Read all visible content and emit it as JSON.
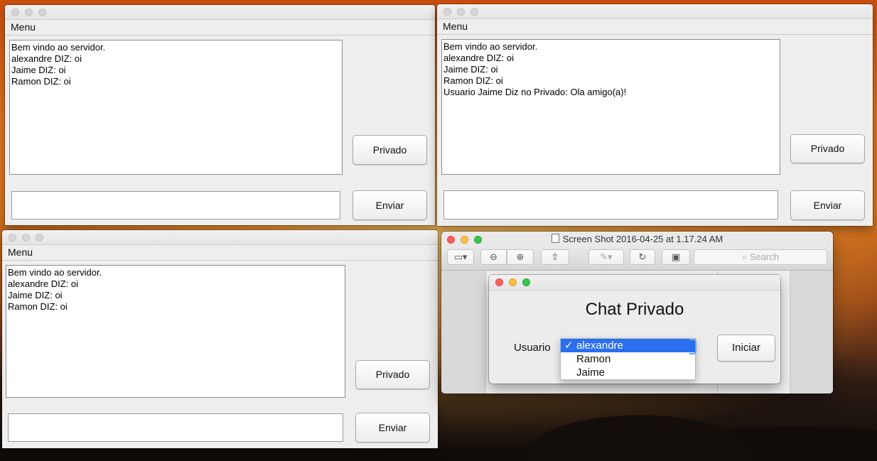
{
  "windows": [
    {
      "menu_label": "Menu",
      "messages": [
        "Bem vindo ao servidor.",
        "alexandre DIZ: oi",
        "Jaime DIZ: oi",
        "Ramon DIZ: oi"
      ],
      "privado_label": "Privado",
      "enviar_label": "Enviar",
      "input_value": ""
    },
    {
      "menu_label": "Menu",
      "messages": [
        "Bem vindo ao servidor.",
        "alexandre DIZ: oi",
        "Jaime DIZ: oi",
        "Ramon DIZ: oi",
        "Usuario Jaime Diz no Privado: Ola amigo(a)!"
      ],
      "privado_label": "Privado",
      "enviar_label": "Enviar",
      "input_value": ""
    },
    {
      "menu_label": "Menu",
      "messages": [
        "Bem vindo ao servidor.",
        "alexandre DIZ: oi",
        "Jaime DIZ: oi",
        "Ramon DIZ: oi"
      ],
      "privado_label": "Privado",
      "enviar_label": "Enviar",
      "input_value": ""
    }
  ],
  "preview": {
    "title": "Screen Shot 2016-04-25 at 1.17.24 AM",
    "search_placeholder": "Search",
    "toolbar_icons": [
      "sidebar-icon",
      "zoom-out-icon",
      "zoom-in-icon",
      "share-icon",
      "markup-pen-icon",
      "rotate-icon",
      "toolbox-icon"
    ]
  },
  "dialog": {
    "heading": "Chat Privado",
    "user_label": "Usuario",
    "options": [
      "alexandre",
      "Ramon",
      "Jaime"
    ],
    "selected_option": "alexandre",
    "checkmark": "✓",
    "start_label": "Iniciar"
  }
}
